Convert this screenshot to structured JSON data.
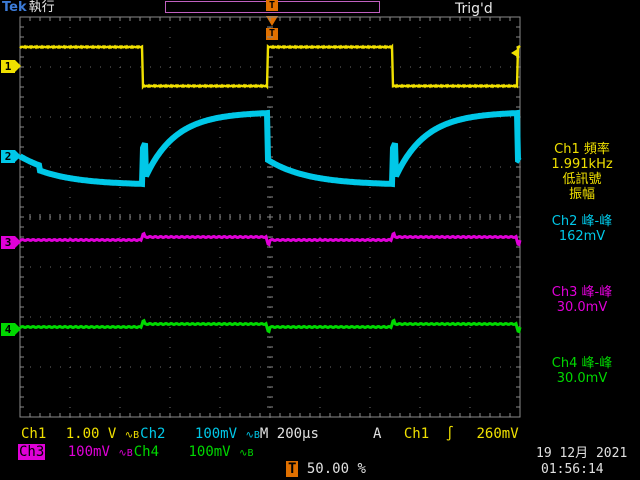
{
  "header": {
    "brand": "Tek",
    "run_state": "執行",
    "trigger_status": "Trig'd",
    "trigger_marker": "T"
  },
  "channels": [
    {
      "id": "1",
      "color": "#f0e000"
    },
    {
      "id": "2",
      "color": "#00c8e8"
    },
    {
      "id": "3",
      "color": "#e000d8"
    },
    {
      "id": "4",
      "color": "#00d800"
    }
  ],
  "measurements": {
    "m1": {
      "line1": "Ch1 頻率",
      "line2": "1.991kHz",
      "line3": "低訊號",
      "line4": "振幅",
      "color": "#f0e000"
    },
    "m2": {
      "line1": "Ch2 峰-峰",
      "line2": "162mV",
      "color": "#00c8e8"
    },
    "m3": {
      "line1": "Ch3 峰-峰",
      "line2": "30.0mV",
      "color": "#e000d8"
    },
    "m4": {
      "line1": "Ch4 峰-峰",
      "line2": "30.0mV",
      "color": "#00d800"
    }
  },
  "status_bar": {
    "ch1_label": "Ch1",
    "ch1_scale": "1.00 V",
    "ch2_label": "Ch2",
    "ch2_scale": "100mV",
    "ch3_label": "Ch3",
    "ch3_scale": "100mV",
    "ch4_label": "Ch4",
    "ch4_scale": "100mV",
    "bw_symbol": "∿B",
    "timebase_label": "M",
    "timebase": "200µs",
    "trigger_mode": "A",
    "trigger_source": "Ch1",
    "trigger_slope": "∫",
    "trigger_level": "260mV",
    "trigger_pos_marker": "T",
    "trigger_position": "50.00 %",
    "date": "19 12月 2021",
    "time": "01:56:14"
  }
}
